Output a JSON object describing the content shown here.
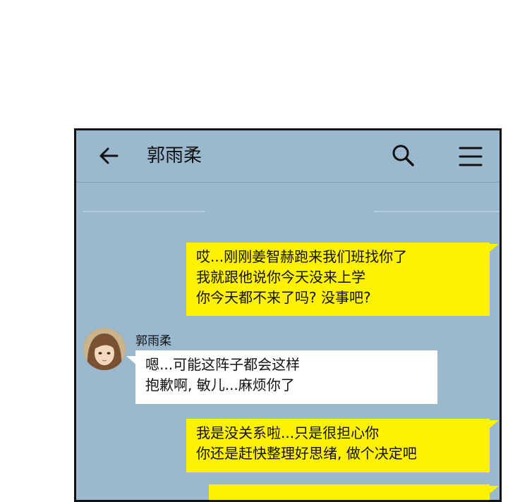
{
  "header": {
    "title": "郭雨柔",
    "back_icon": "arrow-left-icon",
    "search_icon": "search-icon",
    "menu_icon": "hamburger-menu-icon"
  },
  "messages": [
    {
      "from": "me",
      "lines": [
        "哎...刚刚姜智赫跑来我们班找你了",
        "我就跟他说你今天没来上学",
        "你今天都不来了吗? 没事吧?"
      ]
    },
    {
      "from": "other",
      "sender": "郭雨柔",
      "lines": [
        "嗯...可能这阵子都会这样",
        "抱歉啊, 敏儿...麻烦你了"
      ]
    },
    {
      "from": "me",
      "lines": [
        "我是没关系啦...只是很担心你",
        "你还是赶快整理好思绪, 做个决定吧"
      ]
    },
    {
      "from": "me",
      "lines": [
        ""
      ]
    }
  ],
  "colors": {
    "chat_background": "#9ab9cf",
    "my_bubble": "#fff200",
    "their_bubble": "#ffffff"
  }
}
